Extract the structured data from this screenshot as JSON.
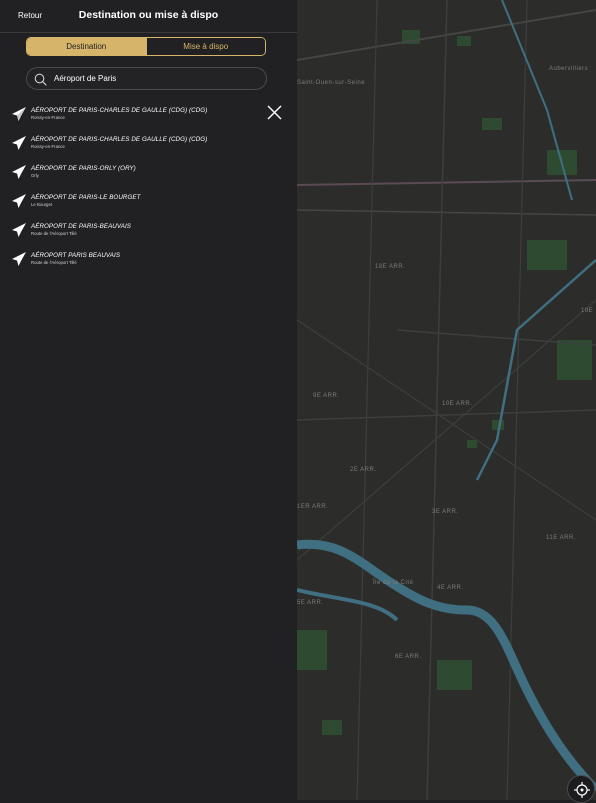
{
  "header": {
    "back_label": "Retour",
    "title": "Destination ou mise à dispo"
  },
  "segmented": {
    "options": [
      "Destination",
      "Mise à dispo"
    ],
    "selected": "Destination"
  },
  "search": {
    "value": "Aéroport de Paris",
    "icon": "search-icon"
  },
  "results": [
    {
      "name": "AÉROPORT DE PARIS-CHARLES DE GAULLE (CDG) (CDG)",
      "subtitle": "Roissy-en-France",
      "icon": "airplane-icon"
    },
    {
      "name": "AÉROPORT DE PARIS-CHARLES DE GAULLE (CDG) (CDG)",
      "subtitle": "Roissy-en-France",
      "icon": "airplane-icon"
    },
    {
      "name": "AÉROPORT DE PARIS-ORLY (ORY)",
      "subtitle": "Orly",
      "icon": "airplane-icon"
    },
    {
      "name": "AÉROPORT DE PARIS-LE BOURGET",
      "subtitle": "Le Bourget",
      "icon": "airplane-icon"
    },
    {
      "name": "AÉROPORT DE PARIS-BEAUVAIS",
      "subtitle": "Route de l'Aéroport Tillé",
      "icon": "airplane-icon"
    },
    {
      "name": "AÉROPORT PARIS BEAUVAIS",
      "subtitle": "Route de l'Aéroport Tillé",
      "icon": "airplane-icon"
    }
  ],
  "map": {
    "labels": [
      "Saint-Ouen-sur-Seine",
      "Aubervilliers",
      "18E ARR.",
      "19E",
      "9E ARR.",
      "10E ARR.",
      "2E ARR.",
      "3E ARR.",
      "1ER ARR.",
      "11E ARR.",
      "Île de la Cité",
      "4E ARR.",
      "6E ARR.",
      "5E ARR."
    ]
  },
  "colors": {
    "accent": "#d6b56a",
    "panel": "#212123",
    "map_base": "#2c2d2b",
    "river": "#3f6f80",
    "park": "#2e4a30"
  }
}
